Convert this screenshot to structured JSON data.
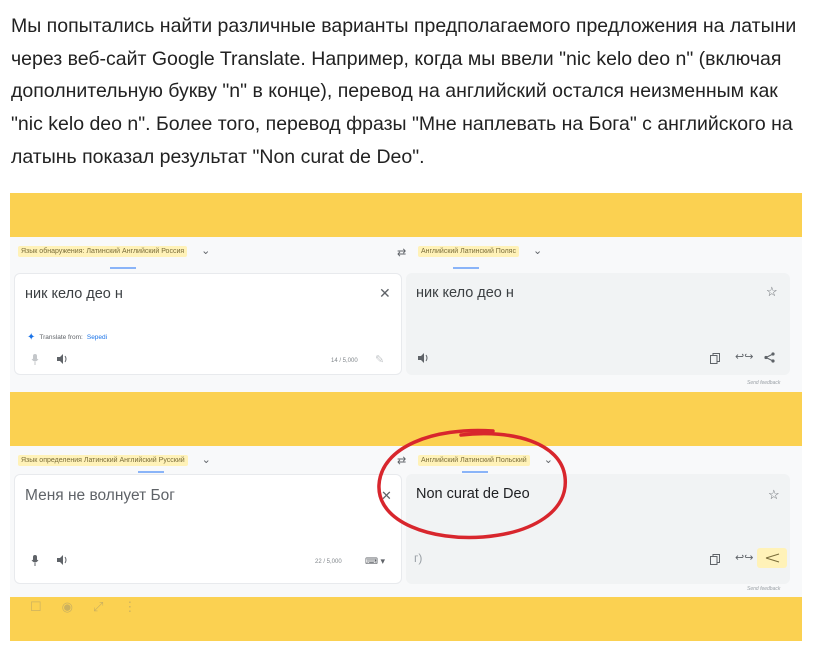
{
  "article": {
    "paragraph": "Мы попытались найти различные варианты предполагаемого предложения на латыни через веб-сайт Google Translate. Например, когда мы ввели \"nic kelo deo n\" (включая дополнительную букву \"n\" в конце), перевод на английский остался неизменным как \"nic kelo deo n\". Более того, перевод фразы \"Мне наплевать на Бога\" с английского на латынь показал результат \"Non curat de Deo\"."
  },
  "screenshot1": {
    "source_lang_bar": "Язык обнаружения: Латинский Английский Россия",
    "target_lang_bar": "Английский Латинский Поляс",
    "source_text": "ник кело део н",
    "target_text": "ник кело део н",
    "translate_from_label": "Translate from:",
    "translate_from_lang": "Sepedi",
    "char_counter": "14 / 5,000",
    "send_feedback": "Send feedback"
  },
  "screenshot2": {
    "source_lang_bar": "Язык определения Латинский Английский Русский",
    "target_lang_bar": "Английский Латинский Польский",
    "source_text": "Меня не волнует Бог",
    "target_text": "Non curat de Deo",
    "char_counter": "22 / 5,000",
    "partial_text": "г)",
    "send_feedback": "Send feedback"
  },
  "colors": {
    "figure_bg": "#fbd151",
    "annotation_circle": "#d8262d",
    "panel_bg": "#f1f3f4"
  }
}
